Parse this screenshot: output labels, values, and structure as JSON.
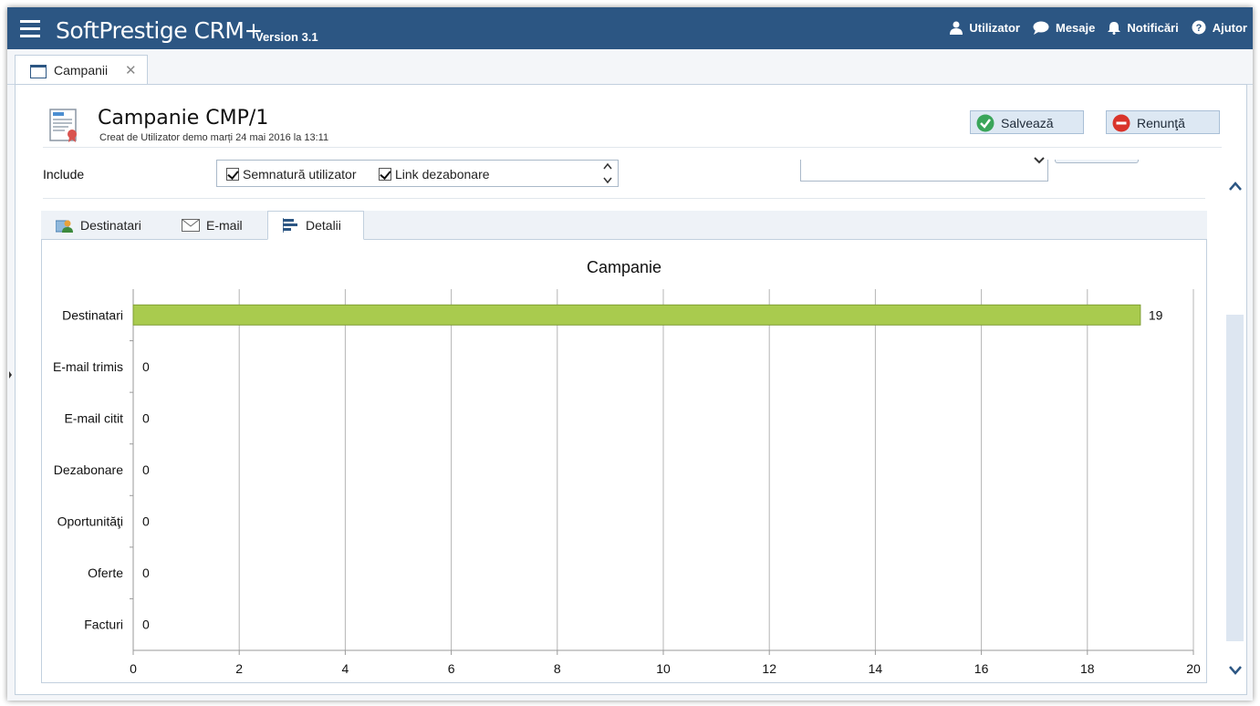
{
  "app": {
    "title": "SoftPrestige CRM+",
    "version": "Version 3.1",
    "menu": [
      {
        "label": "Utilizator",
        "icon": "user-icon"
      },
      {
        "label": "Mesaje",
        "icon": "chat-bubble-icon"
      },
      {
        "label": "Notificări",
        "icon": "bell-icon"
      },
      {
        "label": "Ajutor",
        "icon": "help-circle-icon"
      }
    ]
  },
  "doc_tab": {
    "label": "Campanii",
    "close": "✕"
  },
  "page": {
    "title": "Campanie CMP/1",
    "subtitle": "Creat de Utilizator demo marți 24 mai 2016 la 13:11",
    "save_label": "Salvează",
    "cancel_label": "Renunţă"
  },
  "include": {
    "label": "Include",
    "options": [
      {
        "label": "Semnatură utilizator",
        "checked": true
      },
      {
        "label": "Link dezabonare",
        "checked": true
      }
    ]
  },
  "tabs": [
    {
      "label": "Destinatari",
      "icon": "recipients-icon",
      "active": false
    },
    {
      "label": "E-mail",
      "icon": "envelope-icon",
      "active": false
    },
    {
      "label": "Detalii",
      "icon": "bar-chart-icon",
      "active": true
    }
  ],
  "colors": {
    "header": "#2c5683",
    "bar": "#a9cb4e",
    "bar_border": "#7f9e34"
  },
  "chart_data": {
    "type": "bar",
    "orientation": "horizontal",
    "title": "Campanie",
    "categories": [
      "Destinatari",
      "E-mail trimis",
      "E-mail citit",
      "Dezabonare",
      "Oportunităţi",
      "Oferte",
      "Facturi"
    ],
    "values": [
      19,
      0,
      0,
      0,
      0,
      0,
      0
    ],
    "xlim": [
      0,
      20
    ],
    "xticks": [
      0,
      2,
      4,
      6,
      8,
      10,
      12,
      14,
      16,
      18,
      20
    ],
    "grid": true,
    "legend": "none"
  }
}
